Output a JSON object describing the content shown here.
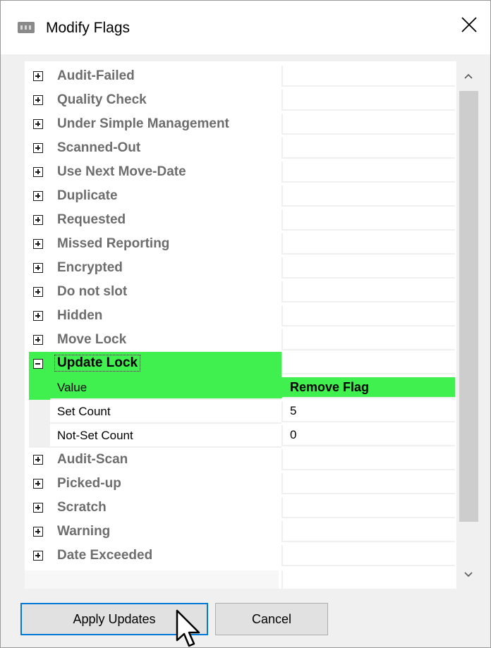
{
  "window": {
    "title": "Modify Flags"
  },
  "flags_before": [
    {
      "label": "Audit-Failed",
      "value": ""
    },
    {
      "label": "Quality Check",
      "value": ""
    },
    {
      "label": "Under Simple Management",
      "value": ""
    },
    {
      "label": "Scanned-Out",
      "value": ""
    },
    {
      "label": "Use Next Move-Date",
      "value": ""
    },
    {
      "label": "Duplicate",
      "value": ""
    },
    {
      "label": "Requested",
      "value": ""
    },
    {
      "label": "Missed Reporting",
      "value": ""
    },
    {
      "label": "Encrypted",
      "value": ""
    },
    {
      "label": "Do not slot",
      "value": ""
    },
    {
      "label": "Hidden",
      "value": ""
    },
    {
      "label": "Move Lock",
      "value": ""
    }
  ],
  "expanded_flag": {
    "label": "Update Lock",
    "properties": [
      {
        "label": "Value",
        "value": "Remove Flag"
      },
      {
        "label": "Set Count",
        "value": "5"
      },
      {
        "label": "Not-Set Count",
        "value": "0"
      }
    ]
  },
  "flags_after": [
    {
      "label": "Audit-Scan",
      "value": ""
    },
    {
      "label": "Picked-up",
      "value": ""
    },
    {
      "label": "Scratch",
      "value": ""
    },
    {
      "label": "Warning",
      "value": ""
    },
    {
      "label": "Date Exceeded",
      "value": ""
    }
  ],
  "buttons": {
    "apply": "Apply Updates",
    "cancel": "Cancel"
  },
  "colors": {
    "selection": "#3ff04f",
    "focus_border": "#0078d7"
  },
  "icons": {
    "app": "app-icon",
    "close": "close-icon",
    "expand": "plus-box-icon",
    "collapse": "minus-box-icon",
    "scroll_up": "chevron-up-icon",
    "scroll_down": "chevron-down-icon",
    "cursor": "mouse-pointer-icon"
  }
}
